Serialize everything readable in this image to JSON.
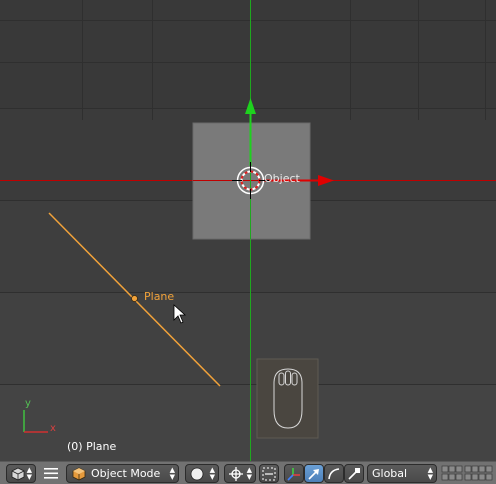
{
  "viewport": {
    "object_label": "Object",
    "plane_label": "Plane",
    "status": "(0) Plane",
    "axis_y": "y",
    "axis_x": "x"
  },
  "header": {
    "editor_type_icon": "3d-view-icon",
    "menu_icon": "hamburger-menu-icon",
    "mode": {
      "icon": "cube-icon",
      "label": "Object Mode"
    },
    "shading_icon": "solid-sphere-icon",
    "pivot_icon": "pivot-point-icon",
    "transform_icons": [
      "manipulator-axes-icon",
      "translate-arrow-icon",
      "rotate-arc-icon",
      "scale-icon"
    ],
    "orientation": "Global",
    "layers_icon": "layers-grid-icon"
  },
  "colors": {
    "background": "#393939",
    "header": "#727272",
    "x_axis": "#d40000",
    "y_axis": "#00c000",
    "selected": "#f1a23a"
  }
}
